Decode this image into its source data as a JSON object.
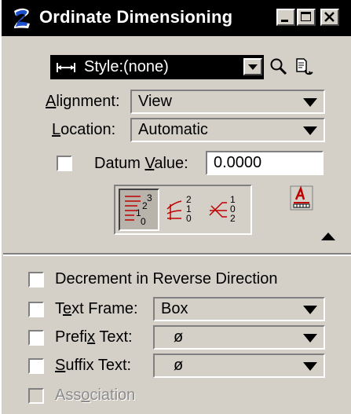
{
  "window": {
    "title": "Ordinate Dimensioning",
    "controls": [
      "minimize",
      "maximize",
      "close"
    ]
  },
  "style": {
    "value": "Style:(none)",
    "icons": [
      "dimension-style-icon",
      "search-icon",
      "match-icon"
    ]
  },
  "alignment": {
    "label": "Alignment:",
    "mnemonic": "A",
    "label_rest": "lignment:",
    "value": "View"
  },
  "location": {
    "label": "Location:",
    "mnemonic": "L",
    "label_rest": "ocation:",
    "value": "Automatic"
  },
  "datum": {
    "label": "Datum Value:",
    "label_pre": "Datum ",
    "mnemonic": "V",
    "label_rest": "alue:",
    "value": "0.0000",
    "checked": false
  },
  "modes": [
    {
      "name": "stacked-ordinate",
      "selected": true
    },
    {
      "name": "free-location",
      "selected": false
    },
    {
      "name": "crossed-ordinate",
      "selected": false
    }
  ],
  "options": {
    "decrement": {
      "label": "Decrement in Reverse Direction",
      "checked": false
    },
    "text_frame": {
      "label": "Text Frame:",
      "label_pre": "T",
      "mnemonic": "e",
      "label_rest": "xt Frame:",
      "value": "Box",
      "checked": false
    },
    "prefix": {
      "label": "Prefix Text:",
      "label_pre": "Prefi",
      "mnemonic": "x",
      "label_rest": " Text:",
      "value": "ø",
      "checked": false
    },
    "suffix": {
      "label": "Suffix Text:",
      "label_pre": "",
      "mnemonic": "S",
      "label_rest": "uffix Text:",
      "value": "ø",
      "checked": false
    },
    "association": {
      "label": "Association",
      "label_pre": "Ass",
      "mnemonic": "o",
      "label_rest": "ciation",
      "checked": false,
      "enabled": false
    }
  },
  "colors": {
    "face": "#d4d0c8",
    "titlebar": "#000000",
    "accent_red": "#c00000",
    "app_icon_blue": "#1a4fd0"
  }
}
